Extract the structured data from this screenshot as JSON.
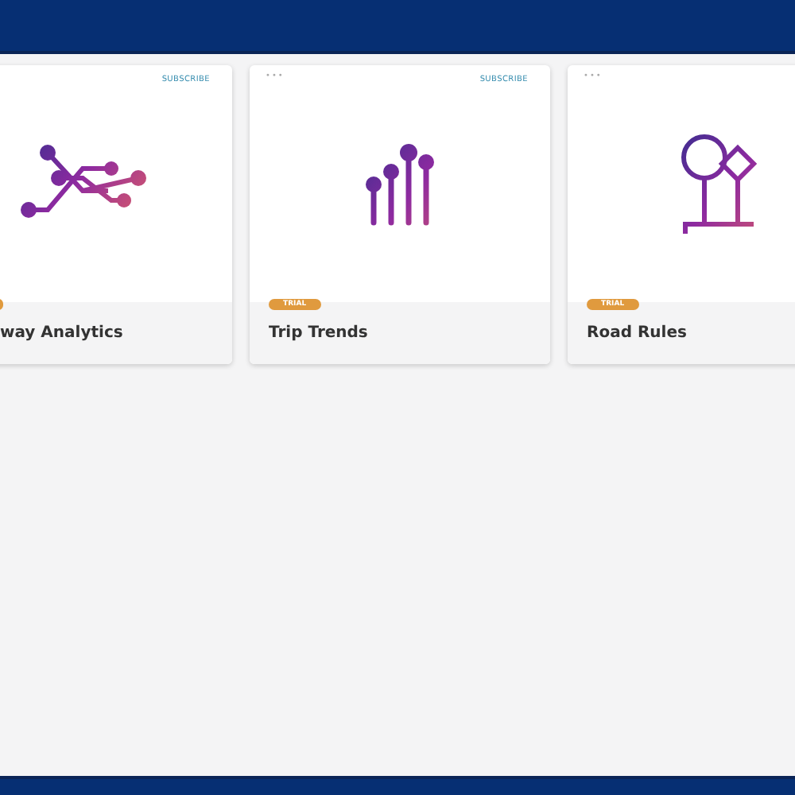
{
  "cards": [
    {
      "title": "way Analytics",
      "kind": "network",
      "subscribe": "SUBSCRIBE",
      "badge_clipped": true
    },
    {
      "title": "Trip Trends",
      "kind": "bars",
      "subscribe": "SUBSCRIBE",
      "menu": "•••",
      "badge": "TRIAL",
      "badge_clipped": false
    },
    {
      "title": "Road Rules",
      "kind": "shapes",
      "menu": "•••",
      "badge": "TRIAL",
      "badge_clipped": false
    }
  ]
}
